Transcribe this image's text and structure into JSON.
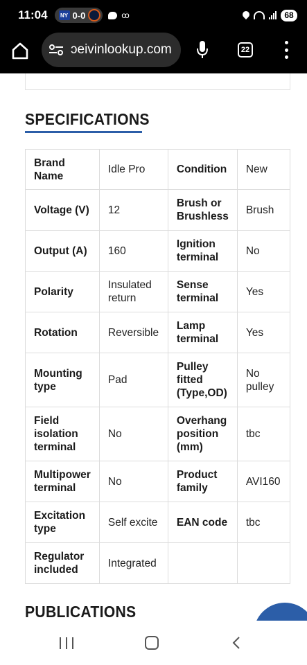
{
  "status_bar": {
    "time": "11:04",
    "score": "0-0",
    "battery": "68",
    "network": "6E"
  },
  "browser": {
    "url": "ɔeivinlookup.com",
    "tab_count": "22"
  },
  "specifications": {
    "title": "SPECIFICATIONS",
    "rows": [
      {
        "l1": "Brand Name",
        "v1": "Idle Pro",
        "l2": "Condition",
        "v2": "New"
      },
      {
        "l1": "Voltage (V)",
        "v1": "12",
        "l2": "Brush or Brushless",
        "v2": "Brush"
      },
      {
        "l1": "Output (A)",
        "v1": "160",
        "l2": "Ignition terminal",
        "v2": "No"
      },
      {
        "l1": "Polarity",
        "v1": "Insulated return",
        "l2": "Sense terminal",
        "v2": "Yes"
      },
      {
        "l1": "Rotation",
        "v1": "Reversible",
        "l2": "Lamp terminal",
        "v2": "Yes"
      },
      {
        "l1": "Mounting type",
        "v1": "Pad",
        "l2": "Pulley fitted (Type,OD)",
        "v2": "No pulley"
      },
      {
        "l1": "Field isolation terminal",
        "v1": "No",
        "l2": "Overhang position (mm)",
        "v2": "tbc"
      },
      {
        "l1": "Multipower terminal",
        "v1": "No",
        "l2": "Product family",
        "v2": "AVI160"
      },
      {
        "l1": "Excitation type",
        "v1": "Self excite",
        "l2": "EAN code",
        "v2": "tbc"
      },
      {
        "l1": "Regulator included",
        "v1": "Integrated",
        "l2": "",
        "v2": ""
      }
    ]
  },
  "publications": {
    "title": "PUBLICATIONS"
  },
  "colors": {
    "accent": "#2c5ea8",
    "toolbar": "#000000"
  }
}
